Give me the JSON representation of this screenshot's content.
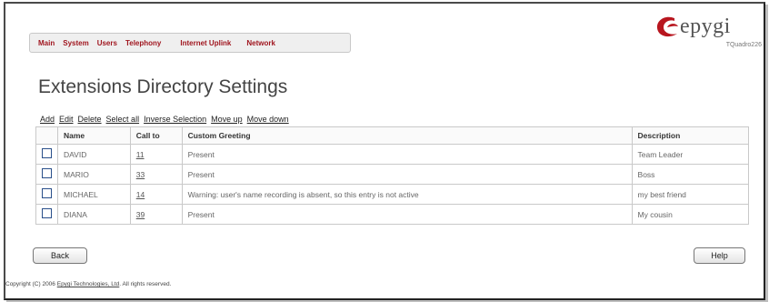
{
  "menu": {
    "items": [
      "Main",
      "System",
      "Users",
      "Telephony",
      "Internet Uplink",
      "Network"
    ]
  },
  "logo": {
    "brand": "epygi",
    "model": "TQuadro226"
  },
  "page": {
    "title": "Extensions Directory Settings"
  },
  "actions": [
    "Add",
    "Edit",
    "Delete",
    "Select all",
    "Inverse Selection",
    "Move up",
    "Move down"
  ],
  "table": {
    "headers": [
      "Name",
      "Call to",
      "Custom Greeting",
      "Description"
    ],
    "rows": [
      {
        "name": "DAVID",
        "call_to": "11",
        "greeting": "Present",
        "description": "Team Leader"
      },
      {
        "name": "MARIO",
        "call_to": "33",
        "greeting": "Present",
        "description": "Boss"
      },
      {
        "name": "MICHAEL",
        "call_to": "14",
        "greeting": "Warning: user's name recording is absent, so this entry is not active",
        "description": "my best friend"
      },
      {
        "name": "DIANA",
        "call_to": "39",
        "greeting": "Present",
        "description": "My cousin"
      }
    ]
  },
  "buttons": {
    "back": "Back",
    "help": "Help"
  },
  "footer": {
    "prefix": "Copyright (C) 2006 ",
    "company": "Epygi Technologies, Ltd",
    "suffix": ". All rights reserved."
  },
  "colors": {
    "menu_text": "#a0161f",
    "logo_red": "#b8161f",
    "checkbox_border": "#2a4f8a"
  }
}
